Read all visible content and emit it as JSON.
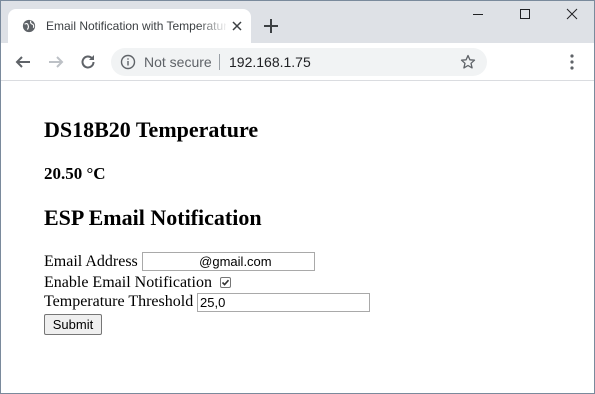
{
  "browser": {
    "tab_title": "Email Notification with Temperature",
    "not_secure": "Not secure",
    "url": "192.168.1.75"
  },
  "page": {
    "heading_temperature": "DS18B20 Temperature",
    "temperature_value": "20.50 °C",
    "heading_email": "ESP Email Notification",
    "form": {
      "email_label": "Email Address",
      "email_value": "               @gmail.com",
      "enable_label": "Enable Email Notification",
      "enable_checked": true,
      "threshold_label": "Temperature Threshold",
      "threshold_value": "25,0",
      "submit_label": "Submit"
    }
  }
}
